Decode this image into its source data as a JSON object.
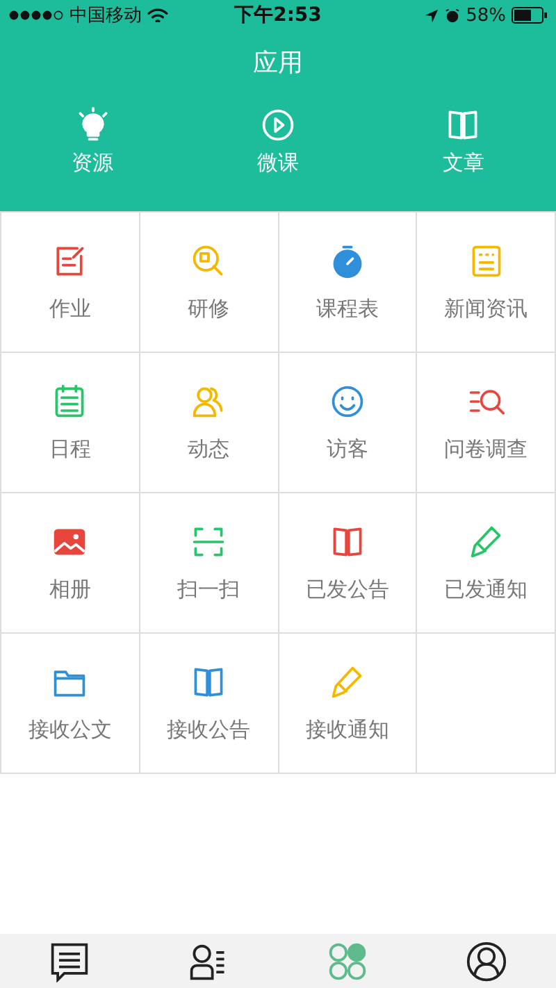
{
  "status_bar": {
    "carrier": "中国移动",
    "time": "下午2:53",
    "battery": "58%"
  },
  "header": {
    "title": "应用"
  },
  "shortcuts": [
    {
      "label": "资源",
      "kind": "bulb"
    },
    {
      "label": "微课",
      "kind": "play"
    },
    {
      "label": "文章",
      "kind": "book"
    }
  ],
  "apps": [
    {
      "label": "作业",
      "kind": "edit",
      "color": "#e8453c"
    },
    {
      "label": "研修",
      "kind": "searchdoc",
      "color": "#f5b800"
    },
    {
      "label": "课程表",
      "kind": "stopwatch",
      "color": "#2f8fd8"
    },
    {
      "label": "新闻资讯",
      "kind": "news",
      "color": "#f5b800"
    },
    {
      "label": "日程",
      "kind": "calendar",
      "color": "#27c46a"
    },
    {
      "label": "动态",
      "kind": "people",
      "color": "#f5b800"
    },
    {
      "label": "访客",
      "kind": "smile",
      "color": "#2f8fd8"
    },
    {
      "label": "问卷调查",
      "kind": "listsearch",
      "color": "#e8453c"
    },
    {
      "label": "相册",
      "kind": "image",
      "color": "#e8453c"
    },
    {
      "label": "扫一扫",
      "kind": "scan",
      "color": "#27c46a"
    },
    {
      "label": "已发公告",
      "kind": "book",
      "color": "#e8453c"
    },
    {
      "label": "已发通知",
      "kind": "pencil",
      "color": "#27c46a"
    },
    {
      "label": "接收公文",
      "kind": "folder",
      "color": "#2f8fd8"
    },
    {
      "label": "接收公告",
      "kind": "book",
      "color": "#2f8fd8"
    },
    {
      "label": "接收通知",
      "kind": "pencil",
      "color": "#f5b800"
    }
  ],
  "tab_bar": [
    {
      "kind": "messages",
      "selected": false
    },
    {
      "kind": "contacts",
      "selected": false
    },
    {
      "kind": "apps",
      "selected": true
    },
    {
      "kind": "profile",
      "selected": false
    }
  ]
}
